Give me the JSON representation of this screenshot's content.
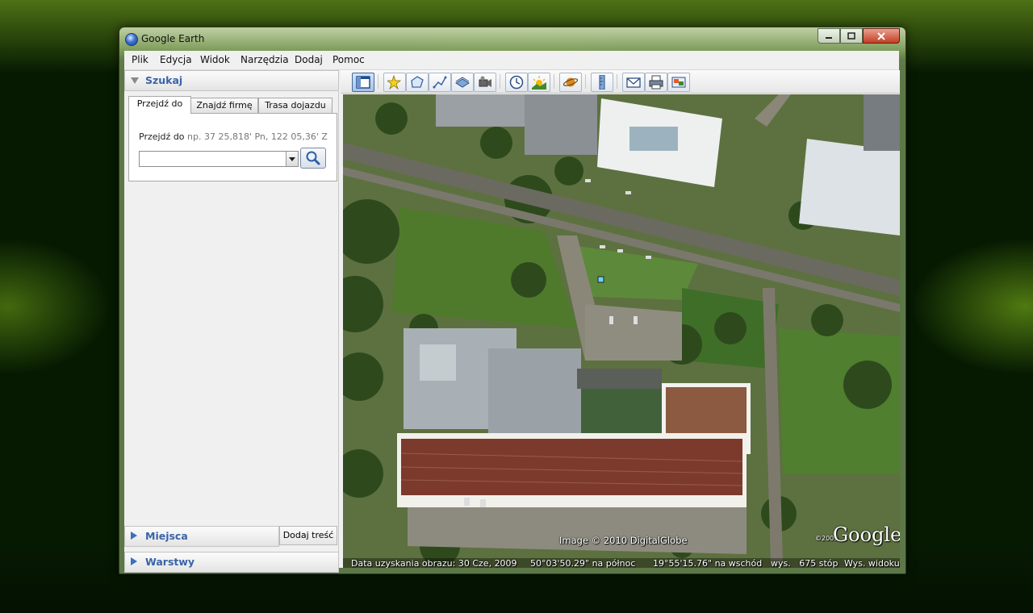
{
  "window": {
    "title": "Google Earth"
  },
  "menu": [
    "Plik",
    "Edycja",
    "Widok",
    "Narzędzia",
    "Dodaj",
    "Pomoc"
  ],
  "search_panel": {
    "title": "Szukaj",
    "tabs": [
      "Przejdź do",
      "Znajdź firmę",
      "Trasa dojazdu"
    ],
    "active_tab": "Przejdź do",
    "goto_label": "Przejdź do",
    "goto_placeholder": "np. 37 25,818' Pn, 122 05,36' Z",
    "input_value": ""
  },
  "places_panel": {
    "title": "Miejsca",
    "add_button": "Dodaj treść"
  },
  "layers_panel": {
    "title": "Warstwy"
  },
  "toolbar": {
    "icons": [
      "hide-sidebar-icon",
      "add-placemark-icon",
      "add-polygon-icon",
      "add-path-icon",
      "add-image-overlay-icon",
      "record-tour-icon",
      "historical-imagery-icon",
      "sunlight-icon",
      "switch-to-sky-icon",
      "ruler-icon",
      "email-icon",
      "print-icon",
      "save-image-icon"
    ]
  },
  "map": {
    "copyright": "Image © 2010 DigitalGlobe",
    "logo_year": "©2009",
    "logo": "Google",
    "status": {
      "imagery_date": "Data uzyskania obrazu: 30 Cze, 2009",
      "latitude": "50°03'50.29\" na północ",
      "longitude": "19°55'15.76\" na wschód",
      "elevation": "wys.   675 stóp",
      "eye_alt": "Wys. widoku"
    }
  },
  "colors": {
    "accent": "#3a63a7",
    "desktop": "#3f7a0a"
  }
}
